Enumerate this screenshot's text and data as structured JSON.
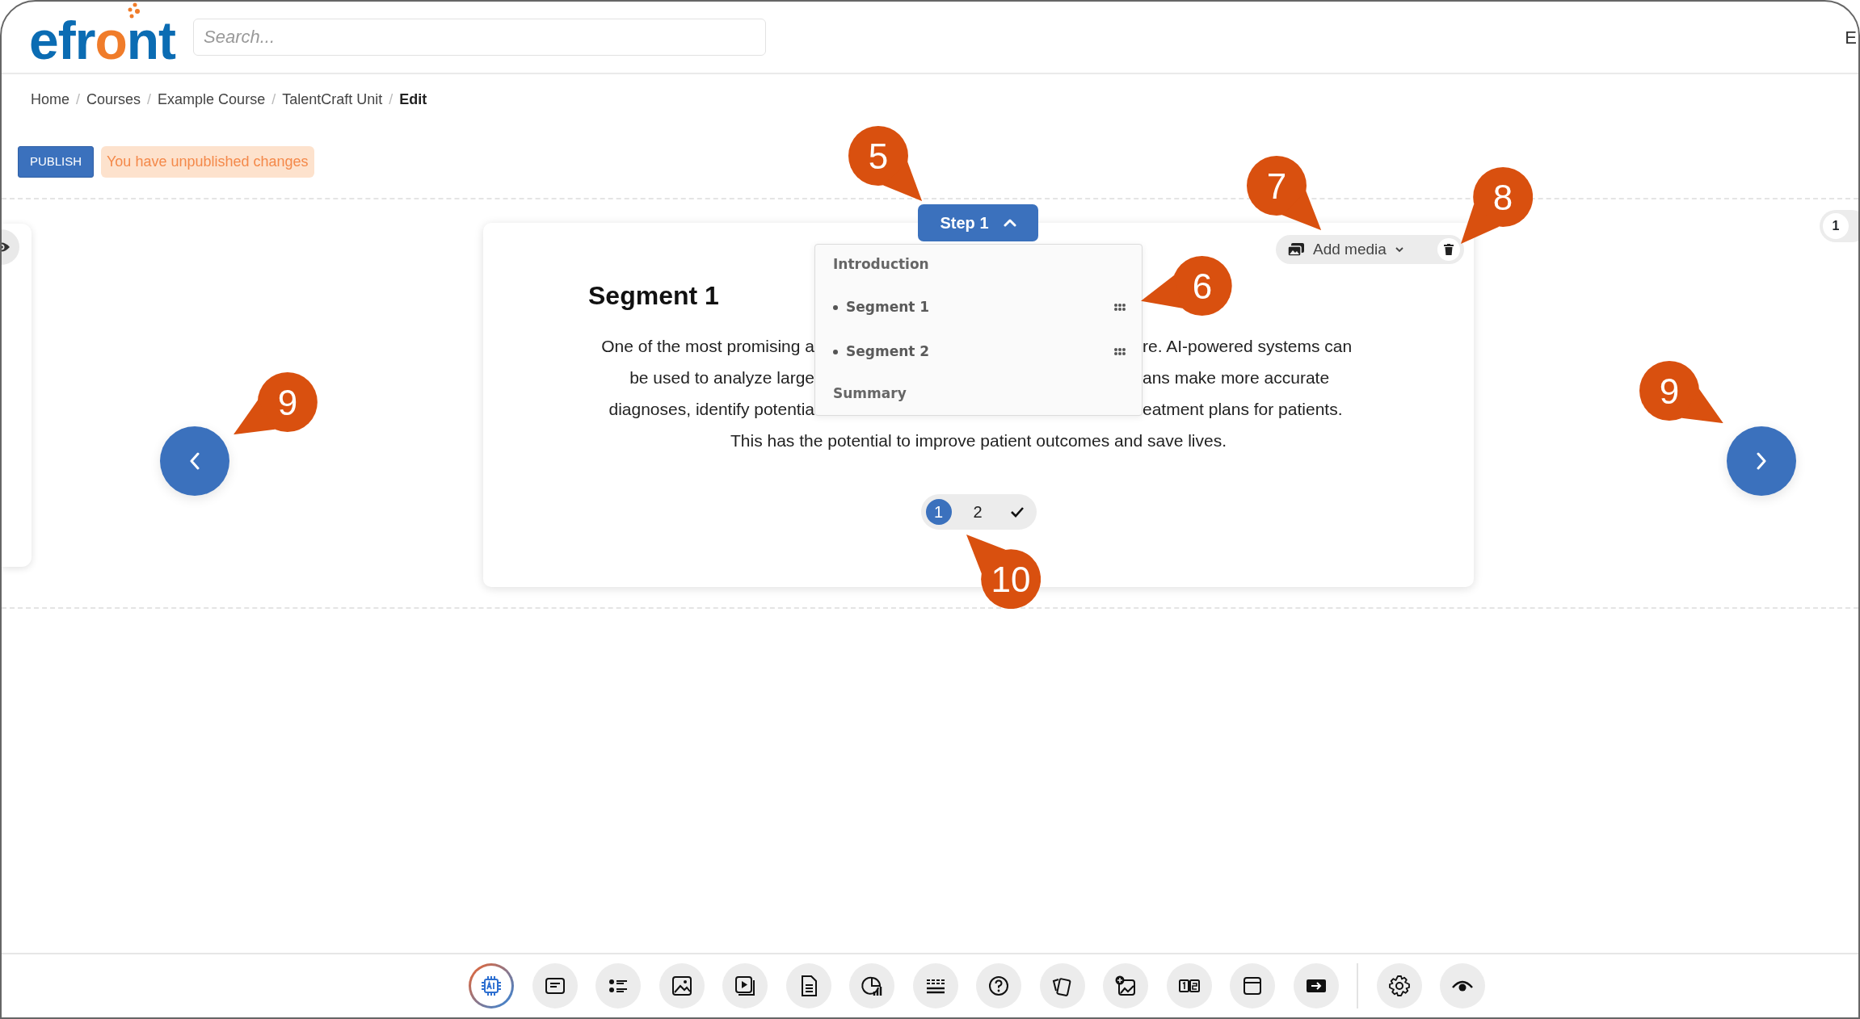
{
  "logo": {
    "parts": [
      {
        "text": "efr",
        "accent": false
      },
      {
        "text": "o",
        "accent": true
      },
      {
        "text": "nt",
        "accent": false
      }
    ]
  },
  "search": {
    "placeholder": "Search..."
  },
  "header_edge_text": "E",
  "breadcrumb": {
    "separator": "/",
    "items": [
      {
        "label": "Home",
        "current": false
      },
      {
        "label": "Courses",
        "current": false
      },
      {
        "label": "Example Course",
        "current": false
      },
      {
        "label": "TalentCraft Unit",
        "current": false
      },
      {
        "label": "Edit",
        "current": true
      }
    ]
  },
  "publish_button": "PUBLISH",
  "status_badge": "You have unpublished changes",
  "step_menu": {
    "label": "Step 1",
    "expanded": true,
    "entries": [
      {
        "kind": "section",
        "label": "Introduction"
      },
      {
        "kind": "item",
        "label": "Segment 1"
      },
      {
        "kind": "item",
        "label": "Segment 2"
      },
      {
        "kind": "section",
        "label": "Summary"
      }
    ]
  },
  "media_button": {
    "label": "Add media"
  },
  "segment": {
    "title": "Segment 1",
    "lines": [
      {
        "left": "One of the most promising a",
        "right": "re. AI-powered systems can"
      },
      {
        "left": "be used to analyze large",
        "right": "ans make more accurate"
      },
      {
        "left": "diagnoses, identify potentia",
        "right": "eatment plans for patients."
      },
      {
        "full": "This has the potential to improve patient outcomes and save lives."
      }
    ]
  },
  "pages": [
    {
      "label": "1",
      "selected": true
    },
    {
      "label": "2",
      "selected": false
    }
  ],
  "side_count": "1",
  "callouts": [
    {
      "label": "5"
    },
    {
      "label": "6"
    },
    {
      "label": "7"
    },
    {
      "label": "8"
    },
    {
      "label": "9"
    },
    {
      "label": "9"
    },
    {
      "label": "10"
    }
  ]
}
